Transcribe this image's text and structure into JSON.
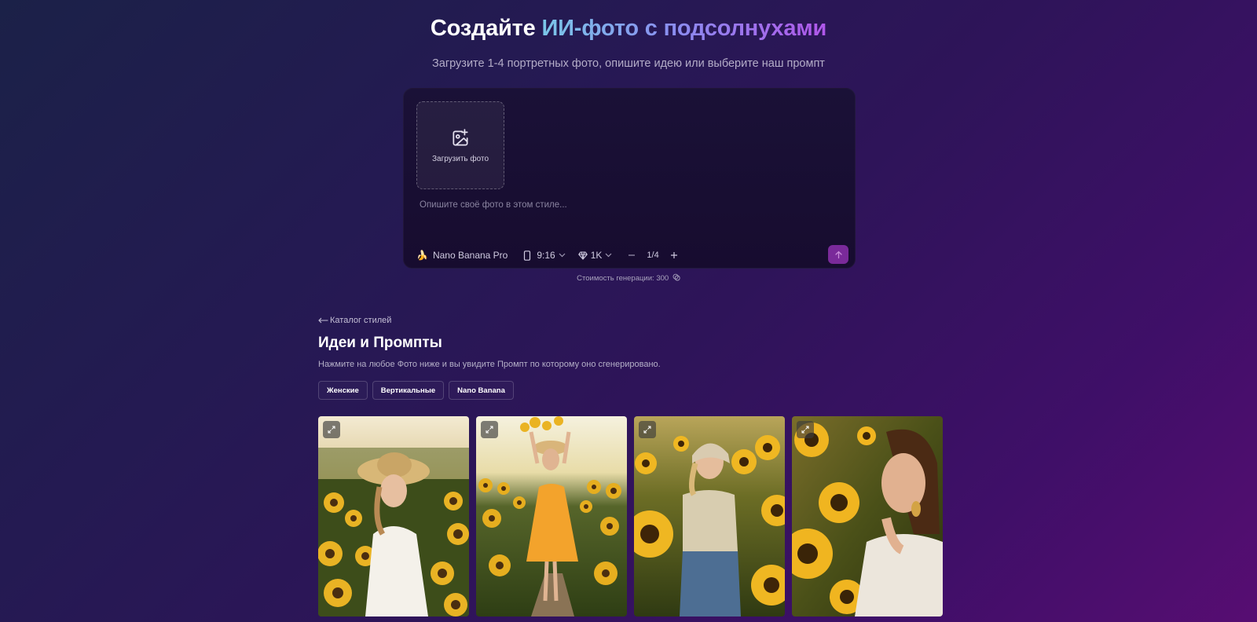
{
  "hero": {
    "title_prefix": "Создайте ",
    "title_accent": "ИИ-фото с подсолнухами",
    "subtitle": "Загрузите 1-4 портретных фото, опишите идею или выберите наш промпт"
  },
  "composer": {
    "upload_label": "Загрузить фото",
    "prompt_placeholder": "Опишите своё фото в этом стиле...",
    "model_emoji": "🍌",
    "model": "Nano Banana Pro",
    "aspect_ratio": "9:16",
    "resolution": "1K",
    "count": "1/4",
    "cost_text": "Стоимость генерации: 300"
  },
  "section": {
    "back_link": "Каталог стилей",
    "title": "Идеи и Промпты",
    "description": "Нажмите на любое Фото ниже и вы увидите Промпт по которому оно сгенерировано.",
    "tags": [
      "Женские",
      "Вертикальные",
      "Nano Banana"
    ]
  },
  "colors": {
    "accent_gradient_start": "#7ac7e8",
    "accent_gradient_end": "#b057ea",
    "send_button": "#7a2a9a"
  },
  "icons": {
    "upload": "image-plus-icon",
    "aspect": "phone-icon",
    "resolution": "diamond-icon",
    "send": "arrow-up-icon",
    "expand": "expand-icon",
    "coin": "coin-icon"
  }
}
